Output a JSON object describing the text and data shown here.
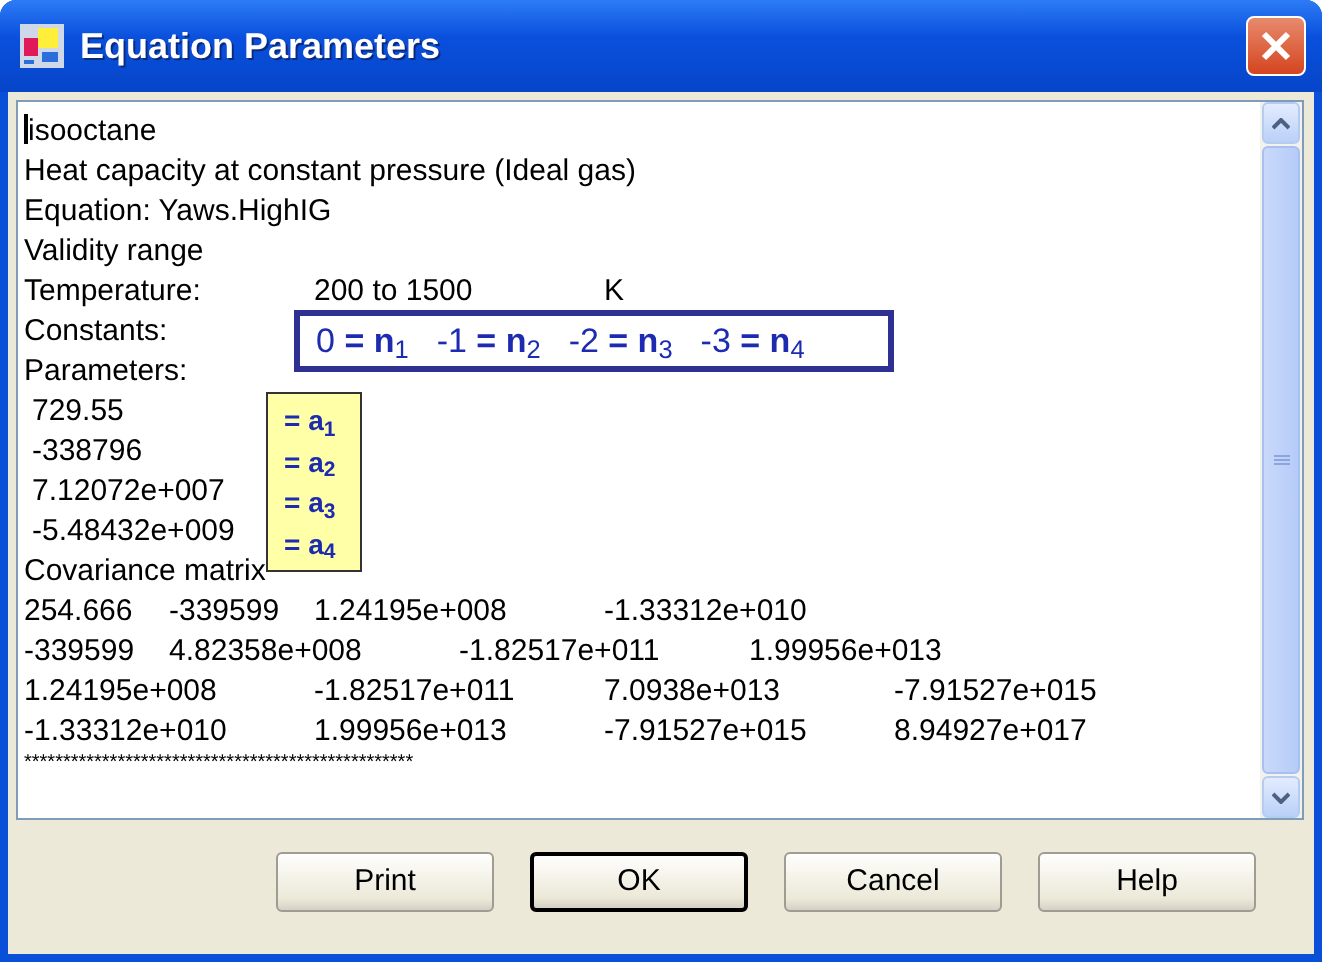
{
  "window": {
    "title": "Equation Parameters"
  },
  "report": {
    "compound": "isooctane",
    "property": "Heat capacity at constant pressure (Ideal gas)",
    "equation": "Equation: Yaws.HighIG",
    "validity_heading": "Validity range",
    "temperature": {
      "label": "Temperature:",
      "range": "200 to 1500",
      "unit": "K"
    },
    "constants_label": "Constants:",
    "parameters_label": "Parameters:",
    "parameters": [
      "729.55",
      "-338796",
      "7.12072e+007",
      "-5.48432e+009"
    ],
    "covariance_heading": "Covariance matrix",
    "covariance_rows": [
      [
        "254.666",
        "-339599",
        "1.24195e+008",
        "-1.33312e+010"
      ],
      [
        "-339599",
        "4.82358e+008",
        "-1.82517e+011",
        "1.99956e+013"
      ],
      [
        "1.24195e+008",
        "-1.82517e+011",
        "7.0938e+013",
        "-7.91527e+015"
      ],
      [
        "-1.33312e+010",
        "1.99956e+013",
        "-7.91527e+015",
        "8.94927e+017"
      ]
    ],
    "separator": "**************************************************"
  },
  "constant_annotations": [
    "0 **= n**$_{1}$",
    "-1 **= n**$_{2}$",
    "-2 **= n**$_{3}$",
    "-3 **= n**$_{4}$"
  ],
  "parameter_annotations": [
    "= a$_{1}$",
    "= a$_{2}$",
    "= a$_{3}$",
    "= a$_{4}$"
  ],
  "buttons": [
    {
      "label": "Print",
      "default": false
    },
    {
      "label": "OK",
      "default": true
    },
    {
      "label": "Cancel",
      "default": false
    },
    {
      "label": "Help",
      "default": false
    }
  ]
}
